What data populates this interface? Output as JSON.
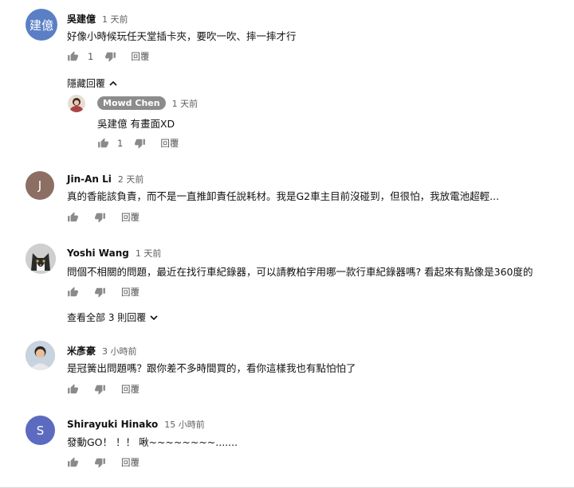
{
  "comments": [
    {
      "author": "吳建億",
      "time": "1 天前",
      "text": "好像小時候玩任天堂插卡夾，要吹一吹、摔一摔才行",
      "likes": "1",
      "reply_label": "回覆",
      "avatar_text": "建億",
      "avatar_color": "#5b7fc4"
    },
    {
      "author": "Jin-An Li",
      "time": "2 天前",
      "text": "真的香能該負責，而不是一直推卸責任說耗材。我是G2車主目前沒碰到，但很怕，我放電池超輕...",
      "reply_label": "回覆",
      "avatar_text": "J",
      "avatar_color": "#8d6e63"
    },
    {
      "author": "Yoshi Wang",
      "time": "1 天前",
      "text": "問個不相關的問題，最近在找行車紀錄器，可以請教柏宇用哪一款行車紀錄器嗎? 看起來有點像是360度的",
      "reply_label": "回覆"
    },
    {
      "author": "米彥豪",
      "time": "3 小時前",
      "text": "是冠簧出問題嗎？跟你差不多時間買的，看你這樣我也有點怕怕了",
      "reply_label": "回覆"
    },
    {
      "author": "Shirayuki Hinako",
      "time": "15 小時前",
      "text": "發動GO！ ！！ 啾~~~~~~~~.......",
      "reply_label": "回覆",
      "avatar_text": "S",
      "avatar_color": "#5c6bc0"
    }
  ],
  "reply": {
    "author": "Mowd Chen",
    "time": "1 天前",
    "text": "吳建億 有畫面XD",
    "likes": "1",
    "reply_label": "回覆"
  },
  "hide_replies_label": "隱藏回覆",
  "view_replies_label": "查看全部 3 則回覆"
}
